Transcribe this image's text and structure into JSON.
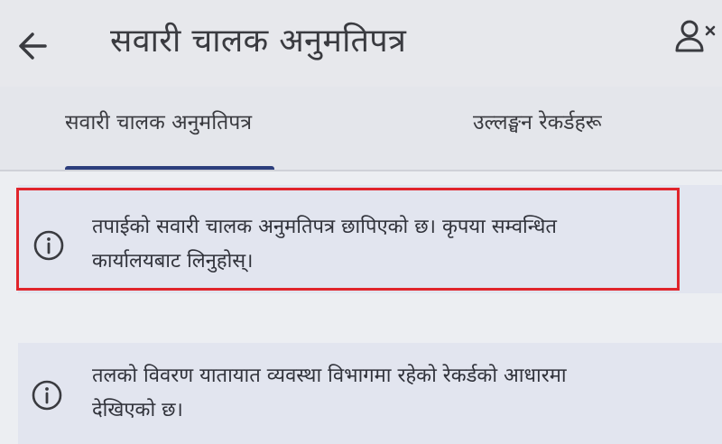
{
  "header": {
    "title": "सवारी चालक अनुमतिपत्र",
    "back_icon": "arrow-left-icon",
    "user_icon": "user-remove-icon"
  },
  "tabs": [
    {
      "label": "सवारी चालक अनुमतिपत्र",
      "active": true
    },
    {
      "label": "उल्लङ्घन रेकर्डहरू",
      "active": false
    }
  ],
  "notices": [
    {
      "icon": "info-icon",
      "text": "तपाईको सवारी चालक अनुमतिपत्र छापिएको छ। कृपया सम्वन्धित\nकार्यालयबाट लिनुहोस्।",
      "highlighted": true
    },
    {
      "icon": "info-icon",
      "text": "तलको विवरण यातायात व्यवस्था विभागमा रहेको रेकर्डको आधारमा\nदेखिएको छ।",
      "highlighted": false
    }
  ],
  "colors": {
    "highlight_border": "#e0242b",
    "tab_indicator": "#2c3e7c",
    "card_background": "#e2e5ef"
  }
}
